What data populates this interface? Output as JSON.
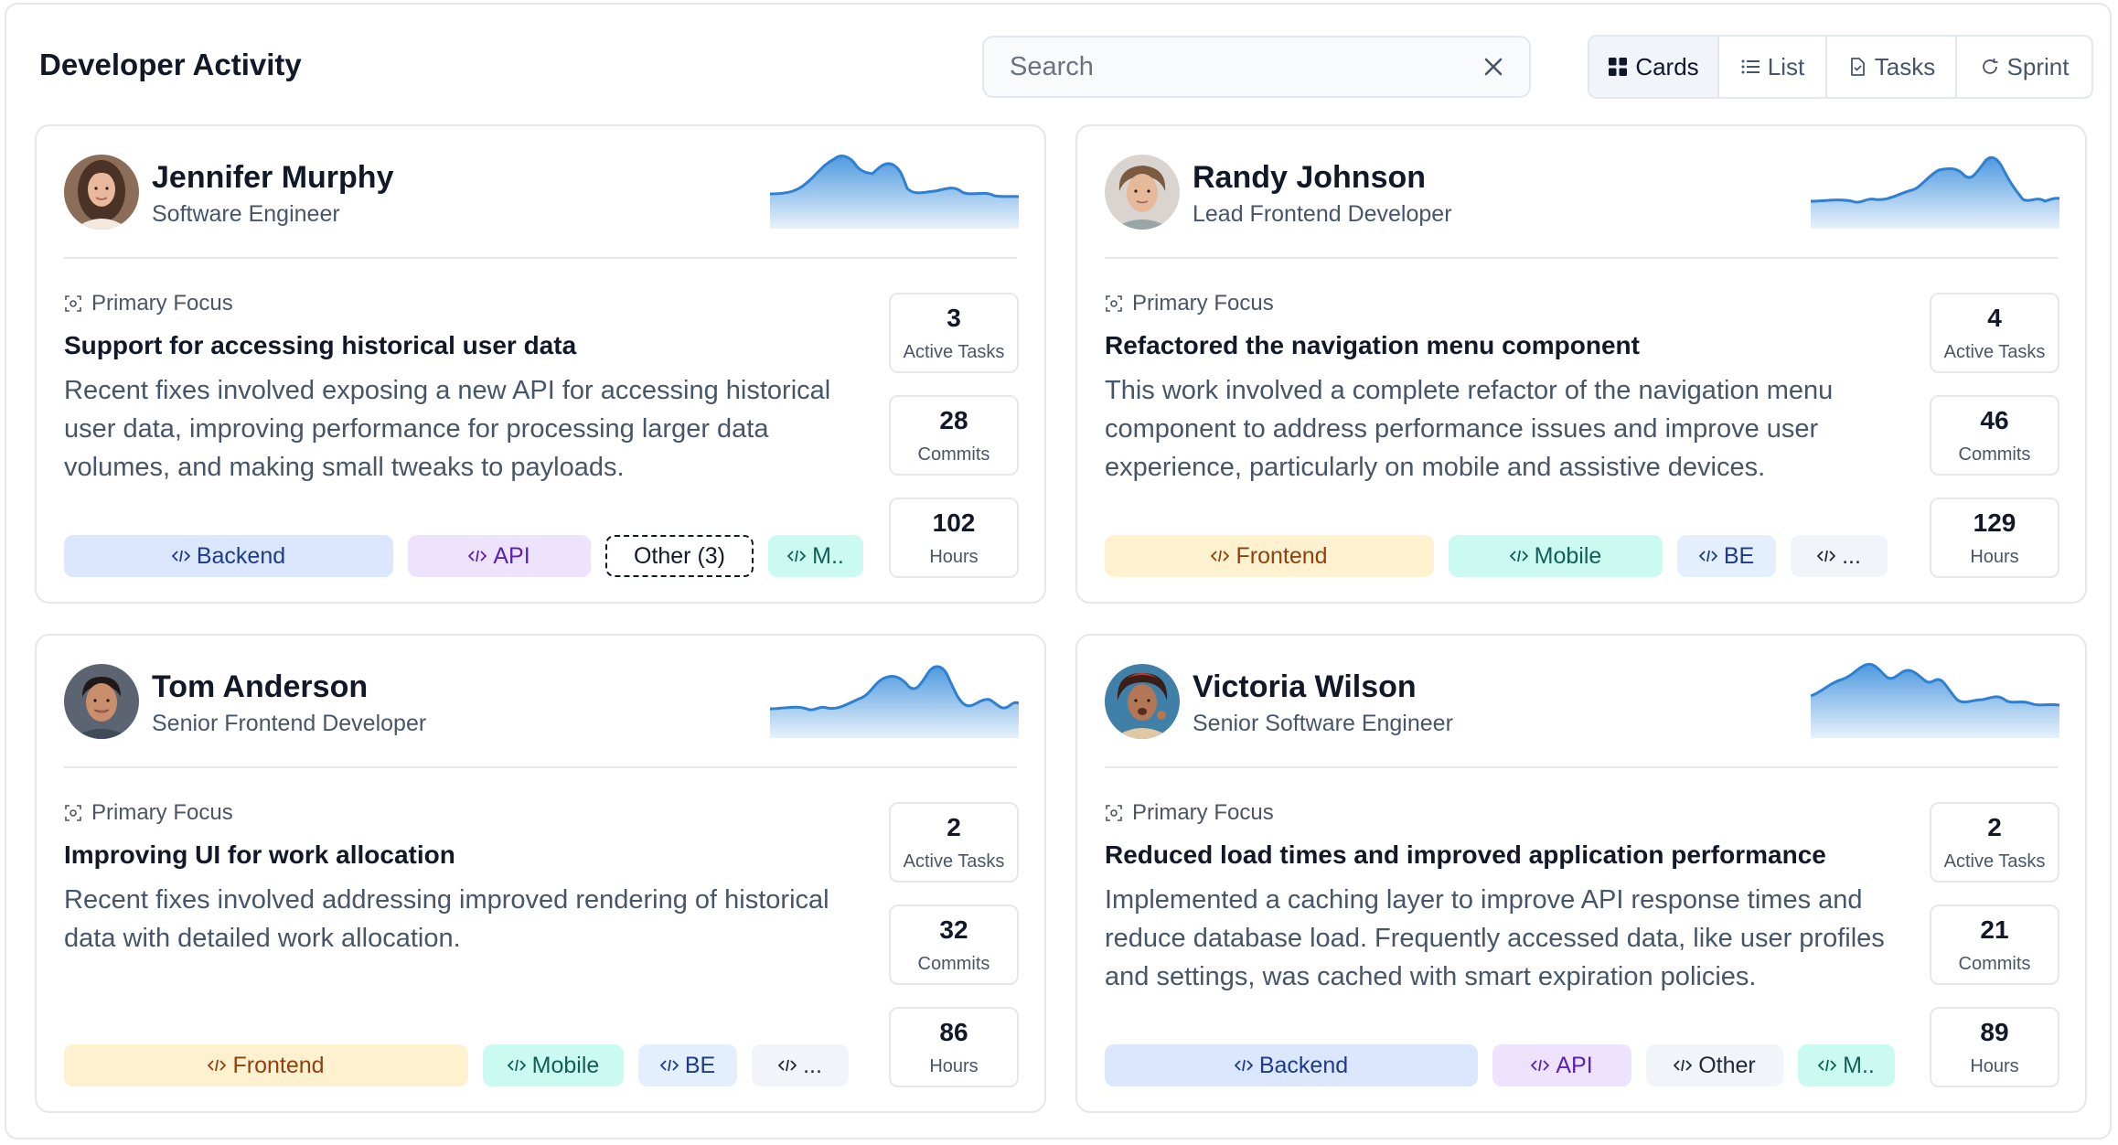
{
  "header": {
    "title": "Developer Activity"
  },
  "search": {
    "placeholder": "Search",
    "value": ""
  },
  "views": [
    {
      "label": "Cards",
      "icon": "grid-icon",
      "active": true
    },
    {
      "label": "List",
      "icon": "list-icon",
      "active": false
    },
    {
      "label": "Tasks",
      "icon": "document-icon",
      "active": false
    },
    {
      "label": "Sprint",
      "icon": "refresh-icon",
      "active": false
    }
  ],
  "colors": {
    "sparkline": "#3b8fdc",
    "accent": "#0f172a"
  },
  "focus_label": "Primary Focus",
  "developers": [
    {
      "name": "Jennifer Murphy",
      "role": "Software Engineer",
      "focus_title": "Support for accessing historical user data",
      "focus_desc": "Recent fixes involved exposing a new API for accessing historical user data, improving performance for processing larger data volumes, and making small tweaks to payloads.",
      "tags": [
        {
          "label": "Backend",
          "style": "blue"
        },
        {
          "label": "API",
          "style": "purple"
        },
        {
          "label": "Other (3)",
          "style": "dashed"
        },
        {
          "label": "M..",
          "style": "teal"
        }
      ],
      "stats": [
        {
          "value": "3",
          "label": "Active Tasks"
        },
        {
          "value": "28",
          "label": "Commits"
        },
        {
          "value": "102",
          "label": "Hours"
        }
      ]
    },
    {
      "name": "Randy Johnson",
      "role": "Lead Frontend Developer",
      "focus_title": "Refactored the navigation menu component",
      "focus_desc": "This work involved a complete refactor of the navigation menu component to address performance issues and improve user experience, particularly on mobile and assistive devices.",
      "tags": [
        {
          "label": "Frontend",
          "style": "yellow"
        },
        {
          "label": "Mobile",
          "style": "teal"
        },
        {
          "label": "BE",
          "style": "lightblue"
        },
        {
          "label": "...",
          "style": "gray"
        }
      ],
      "stats": [
        {
          "value": "4",
          "label": "Active Tasks"
        },
        {
          "value": "46",
          "label": "Commits"
        },
        {
          "value": "129",
          "label": "Hours"
        }
      ]
    },
    {
      "name": "Tom Anderson",
      "role": "Senior Frontend Developer",
      "focus_title": "Improving UI for work allocation",
      "focus_desc": "Recent fixes involved addressing improved rendering of historical data with detailed work allocation.",
      "tags": [
        {
          "label": "Frontend",
          "style": "yellow"
        },
        {
          "label": "Mobile",
          "style": "teal"
        },
        {
          "label": "BE",
          "style": "lightblue"
        },
        {
          "label": "...",
          "style": "gray"
        }
      ],
      "stats": [
        {
          "value": "2",
          "label": "Active Tasks"
        },
        {
          "value": "32",
          "label": "Commits"
        },
        {
          "value": "86",
          "label": "Hours"
        }
      ]
    },
    {
      "name": "Victoria Wilson",
      "role": "Senior Software Engineer",
      "focus_title": "Reduced load times and improved application performance",
      "focus_desc": "Implemented a caching layer to improve API response times and reduce database load. Frequently accessed data, like user profiles and settings, was cached with smart expiration policies.",
      "tags": [
        {
          "label": "Backend",
          "style": "blue"
        },
        {
          "label": "API",
          "style": "purple"
        },
        {
          "label": "Other",
          "style": "gray"
        },
        {
          "label": "M..",
          "style": "teal"
        }
      ],
      "stats": [
        {
          "value": "2",
          "label": "Active Tasks"
        },
        {
          "value": "21",
          "label": "Commits"
        },
        {
          "value": "89",
          "label": "Hours"
        }
      ]
    }
  ]
}
